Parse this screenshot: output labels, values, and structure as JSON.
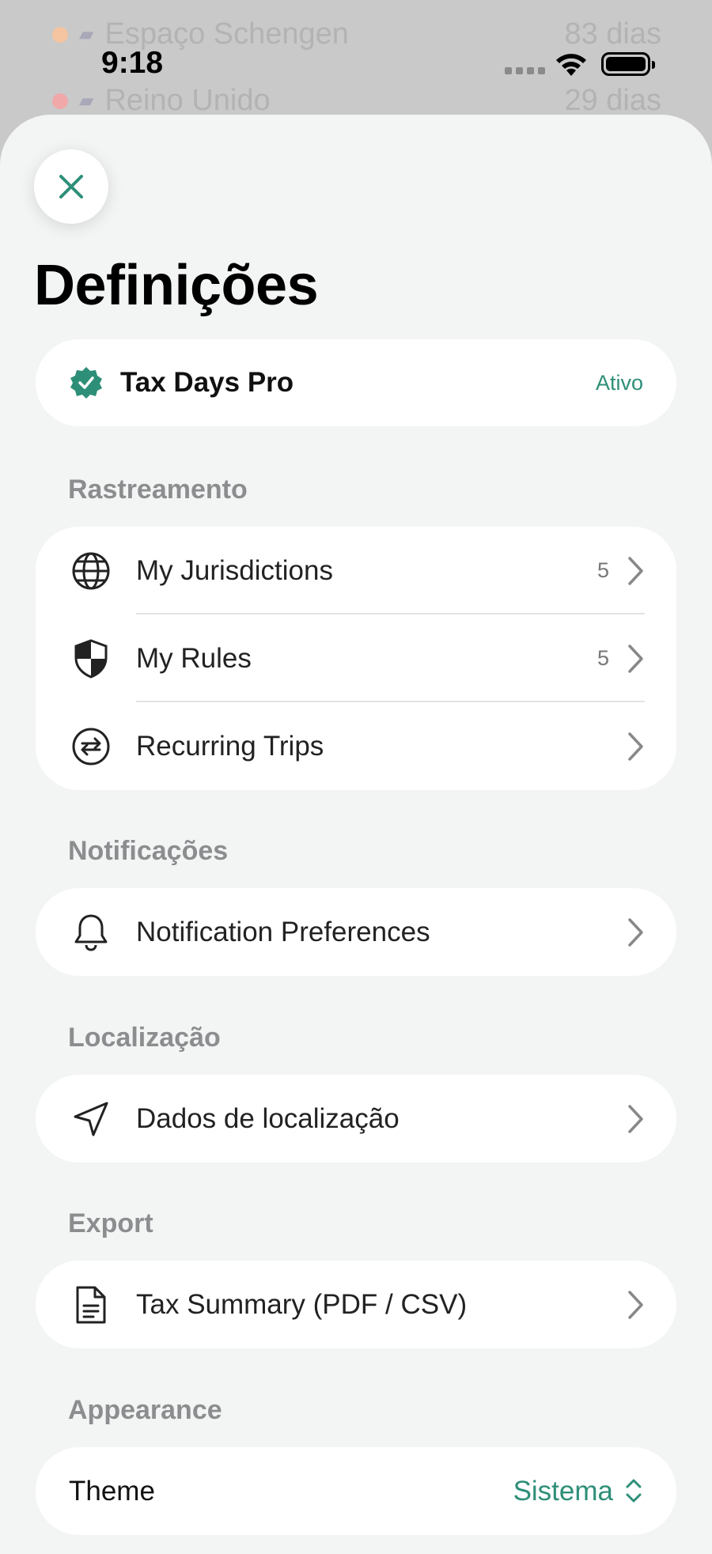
{
  "status_bar": {
    "time": "9:18"
  },
  "background_list": [
    {
      "name": "Espaço Schengen",
      "days": "83 dias",
      "dot_color": "#f5c4a0"
    },
    {
      "name": "Reino Unido",
      "days": "29 dias",
      "dot_color": "#f0a8a8"
    }
  ],
  "page": {
    "title": "Definições"
  },
  "subscription": {
    "name": "Tax Days Pro",
    "status": "Ativo"
  },
  "sections": {
    "tracking": {
      "header": "Rastreamento",
      "items": [
        {
          "label": "My Jurisdictions",
          "count": "5",
          "icon": "globe-icon"
        },
        {
          "label": "My Rules",
          "count": "5",
          "icon": "shield-icon"
        },
        {
          "label": "Recurring Trips",
          "count": "",
          "icon": "recurring-icon"
        }
      ]
    },
    "notifications": {
      "header": "Notificações",
      "items": [
        {
          "label": "Notification Preferences",
          "icon": "bell-icon"
        }
      ]
    },
    "location": {
      "header": "Localização",
      "items": [
        {
          "label": "Dados de localização",
          "icon": "location-arrow-icon"
        }
      ]
    },
    "export": {
      "header": "Export",
      "items": [
        {
          "label": "Tax Summary (PDF / CSV)",
          "icon": "document-icon"
        }
      ]
    },
    "appearance": {
      "header": "Appearance",
      "theme_label": "Theme",
      "theme_value": "Sistema"
    }
  },
  "colors": {
    "accent": "#2e8f78",
    "section_header": "#8c8d8f",
    "sheet_bg": "#f3f4f4"
  }
}
